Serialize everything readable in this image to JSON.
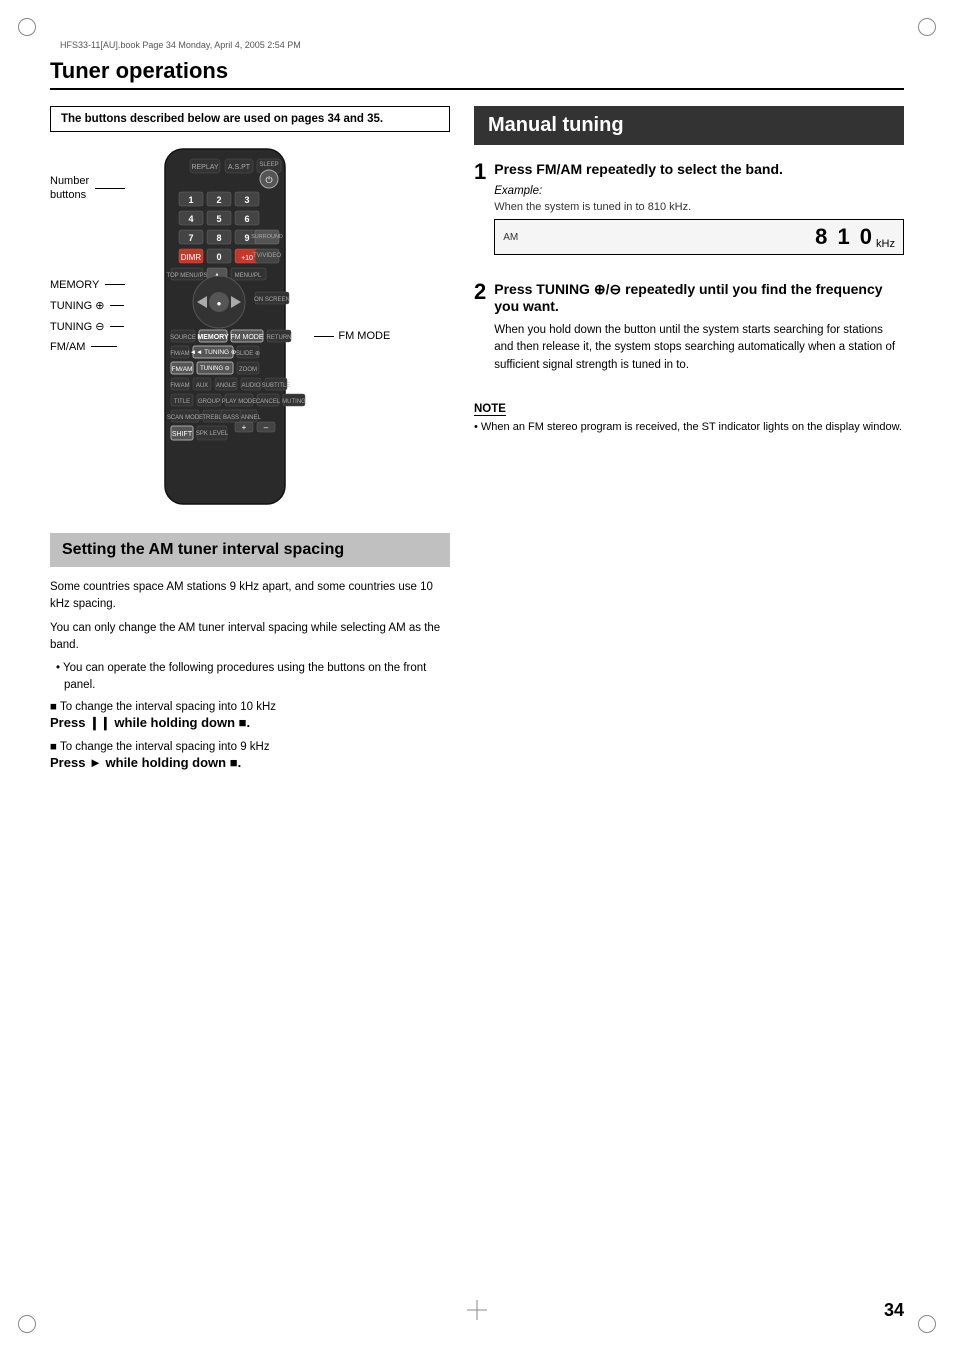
{
  "page": {
    "file_info": "HFS33-11[AU].book  Page 34  Monday, April 4, 2005  2:54 PM",
    "title": "Tuner operations",
    "page_number": "34"
  },
  "buttons_box": {
    "text": "The buttons described below are used on pages 34 and 35."
  },
  "remote_labels": [
    {
      "id": "number-buttons",
      "text": "Number\nbuttons"
    },
    {
      "id": "memory-label",
      "text": "MEMORY"
    },
    {
      "id": "tuning-up-label",
      "text": "TUNING ⊕"
    },
    {
      "id": "tuning-down-label",
      "text": "TUNING ⊖"
    },
    {
      "id": "fmam-label",
      "text": "FM/AM"
    },
    {
      "id": "fm-mode-label",
      "text": "FM MODE"
    }
  ],
  "setting_section": {
    "header": "Setting the AM tuner interval spacing",
    "para1": "Some countries space AM stations 9 kHz apart, and some countries use 10 kHz spacing.",
    "para2": "You can only change the AM tuner interval spacing while selecting AM as the band.",
    "bullet1": "You can operate the following procedures using the buttons on the front panel.",
    "instruction1_prefix": "■ To change the interval spacing into 10 kHz",
    "instruction1_bold": "Press ❙❙ while holding down ■.",
    "instruction2_prefix": "■ To change the interval spacing into 9 kHz",
    "instruction2_bold": "Press ► while holding down ■."
  },
  "manual_tuning": {
    "header": "Manual tuning",
    "step1": {
      "number": "1",
      "heading": "Press FM/AM repeatedly to select the band.",
      "example_label": "Example:",
      "when_label": "When the system is tuned in to 810 kHz.",
      "display_am": "AM",
      "display_freq": "8 1 0",
      "display_unit": "kHz"
    },
    "step2": {
      "number": "2",
      "heading": "Press TUNING ⊕/⊖ repeatedly until you find the frequency you want.",
      "body": "When you hold down the button until the system starts searching for stations and then release it, the system stops searching automatically when a station of sufficient signal strength is tuned in to."
    },
    "note": {
      "title": "NOTE",
      "bullet": "When an FM stereo program is received, the ST indicator lights on the display window."
    }
  }
}
